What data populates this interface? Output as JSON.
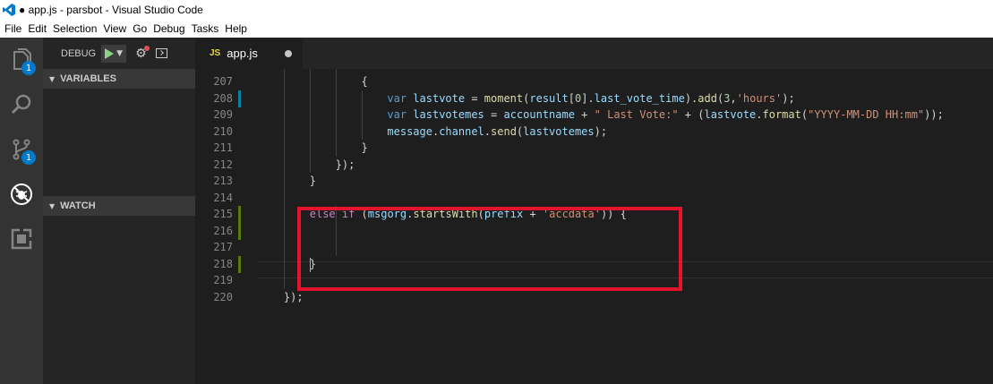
{
  "window": {
    "title": "● app.js - parsbot - Visual Studio Code"
  },
  "menu": [
    "File",
    "Edit",
    "Selection",
    "View",
    "Go",
    "Debug",
    "Tasks",
    "Help"
  ],
  "activity_bar": {
    "items": [
      {
        "name": "explorer-icon",
        "badge": "1"
      },
      {
        "name": "search-icon",
        "badge": ""
      },
      {
        "name": "source-control-icon",
        "badge": "1"
      },
      {
        "name": "debug-icon",
        "badge": ""
      },
      {
        "name": "extensions-icon",
        "badge": ""
      }
    ]
  },
  "sidebar": {
    "debug_label": "DEBUG",
    "variables_header": "VARIABLES",
    "watch_header": "WATCH"
  },
  "tabs": [
    {
      "icon_text": "JS",
      "label": "app.js",
      "dirty": true
    }
  ],
  "editor": {
    "lines": [
      {
        "num": "207",
        "tokens": [
          [
            "pl",
            "{"
          ]
        ],
        "indent": 16
      },
      {
        "num": "208",
        "tokens": [
          [
            "vr",
            "var "
          ],
          [
            "id",
            "lastvote"
          ],
          [
            "pl",
            " = "
          ],
          [
            "fn",
            "moment"
          ],
          [
            "pl",
            "("
          ],
          [
            "id",
            "result"
          ],
          [
            "pl",
            "["
          ],
          [
            "nm",
            "0"
          ],
          [
            "pl",
            "]."
          ],
          [
            "id",
            "last_vote_time"
          ],
          [
            "pl",
            ")."
          ],
          [
            "fn",
            "add"
          ],
          [
            "pl",
            "("
          ],
          [
            "nm",
            "3"
          ],
          [
            "pl",
            ","
          ],
          [
            "st",
            "'hours'"
          ],
          [
            "pl",
            ");"
          ]
        ],
        "indent": 20
      },
      {
        "num": "209",
        "tokens": [
          [
            "vr",
            "var "
          ],
          [
            "id",
            "lastvotemes"
          ],
          [
            "pl",
            " = "
          ],
          [
            "id",
            "accountname"
          ],
          [
            "pl",
            " + "
          ],
          [
            "st",
            "\" Last Vote:\""
          ],
          [
            "pl",
            " + ("
          ],
          [
            "id",
            "lastvote"
          ],
          [
            "pl",
            "."
          ],
          [
            "fn",
            "format"
          ],
          [
            "pl",
            "("
          ],
          [
            "st",
            "\"YYYY-MM-DD HH:mm\""
          ],
          [
            "pl",
            "));"
          ]
        ],
        "indent": 20
      },
      {
        "num": "210",
        "tokens": [
          [
            "id",
            "message"
          ],
          [
            "pl",
            "."
          ],
          [
            "id",
            "channel"
          ],
          [
            "pl",
            "."
          ],
          [
            "fn",
            "send"
          ],
          [
            "pl",
            "("
          ],
          [
            "id",
            "lastvotemes"
          ],
          [
            "pl",
            ");"
          ]
        ],
        "indent": 20
      },
      {
        "num": "211",
        "tokens": [
          [
            "pl",
            "}"
          ]
        ],
        "indent": 16
      },
      {
        "num": "212",
        "tokens": [
          [
            "pl",
            "});"
          ]
        ],
        "indent": 12
      },
      {
        "num": "213",
        "tokens": [
          [
            "pl",
            "}"
          ]
        ],
        "indent": 8
      },
      {
        "num": "214",
        "tokens": [],
        "indent": 0
      },
      {
        "num": "215",
        "tokens": [
          [
            "kw",
            "else if"
          ],
          [
            "pl",
            " ("
          ],
          [
            "id",
            "msgorg"
          ],
          [
            "pl",
            "."
          ],
          [
            "fn",
            "startsWith"
          ],
          [
            "pl",
            "("
          ],
          [
            "id",
            "prefix"
          ],
          [
            "pl",
            " + "
          ],
          [
            "st",
            "'accdata'"
          ],
          [
            "pl",
            ")) {"
          ]
        ],
        "indent": 8
      },
      {
        "num": "216",
        "tokens": [],
        "indent": 0
      },
      {
        "num": "217",
        "tokens": [],
        "indent": 0
      },
      {
        "num": "218",
        "tokens": [
          [
            "pl",
            "}"
          ]
        ],
        "indent": 8
      },
      {
        "num": "219",
        "tokens": [],
        "indent": 0
      },
      {
        "num": "220",
        "tokens": [
          [
            "pl",
            "});"
          ]
        ],
        "indent": 4
      }
    ],
    "gutter_marks": {
      "208": "#0c7d9d",
      "215": "#587c0c",
      "216": "#587c0c",
      "218": "#587c0c"
    }
  },
  "colors": {
    "highlight_box": "#e3142b",
    "badge": "#007acc"
  }
}
